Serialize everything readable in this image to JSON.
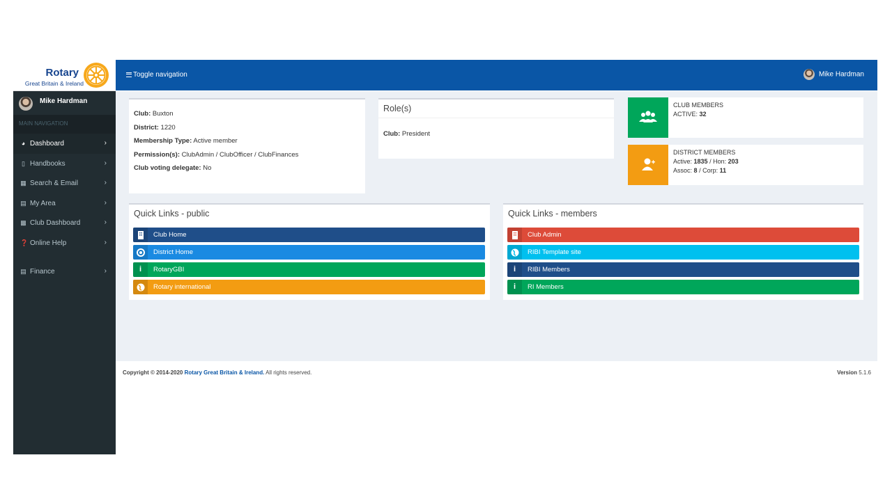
{
  "logo": {
    "title": "Rotary",
    "subtitle": "Great Britain & Ireland"
  },
  "topbar": {
    "toggle_label": "Toggle navigation",
    "user_name": "Mike Hardman"
  },
  "sidebar": {
    "user_name": "Mike Hardman",
    "header": "MAIN NAVIGATION",
    "items": [
      {
        "label": "Dashboard",
        "icon": "dashboard-icon"
      },
      {
        "label": "Handbooks",
        "icon": "book-icon"
      },
      {
        "label": "Search & Email",
        "icon": "table-icon"
      },
      {
        "label": "My Area",
        "icon": "database-icon"
      },
      {
        "label": "Club Dashboard",
        "icon": "building-icon"
      },
      {
        "label": "Online Help",
        "icon": "question-icon"
      },
      {
        "label": "Finance",
        "icon": "database-icon"
      }
    ]
  },
  "club_info": {
    "club_label": "Club:",
    "club_value": "Buxton",
    "district_label": "District:",
    "district_value": "1220",
    "membership_label": "Membership Type:",
    "membership_value": "Active member",
    "permissions_label": "Permission(s):",
    "permissions_value": "ClubAdmin / ClubOfficer / ClubFinances",
    "voting_label": "Club voting delegate:",
    "voting_value": "No"
  },
  "roles": {
    "title": "Role(s)",
    "club_label": "Club:",
    "club_value": "President"
  },
  "club_members": {
    "title": "CLUB MEMBERS",
    "active_label": "ACTIVE:",
    "active_value": "32",
    "color": "#00a65a"
  },
  "district_members": {
    "title": "DISTRICT MEMBERS",
    "active_label": "Active:",
    "active_value": "1835",
    "hon_label": "/ Hon:",
    "hon_value": "203",
    "assoc_label": "Assoc:",
    "assoc_value": "8",
    "corp_label": "/ Corp:",
    "corp_value": "11",
    "color": "#f39c12"
  },
  "quick_public": {
    "title": "Quick Links - public",
    "links": [
      {
        "label": "Club Home",
        "color": "#1f4e89",
        "icon": "building-icon"
      },
      {
        "label": "District Home",
        "color": "#1a8ae2",
        "icon": "life-ring-icon"
      },
      {
        "label": "RotaryGBI",
        "color": "#00a65a",
        "icon": "info-icon"
      },
      {
        "label": "Rotary international",
        "color": "#f39c12",
        "icon": "globe-icon"
      }
    ]
  },
  "quick_members": {
    "title": "Quick Links - members",
    "links": [
      {
        "label": "Club Admin",
        "color": "#dd4b39",
        "icon": "building-icon"
      },
      {
        "label": "RIBI Template site",
        "color": "#00c0ef",
        "icon": "globe-icon"
      },
      {
        "label": "RIBI Members",
        "color": "#1f4e89",
        "icon": "info-icon"
      },
      {
        "label": "RI Members",
        "color": "#00a65a",
        "icon": "info-icon"
      }
    ]
  },
  "footer": {
    "copyright": "Copyright © 2014-2020",
    "org_link": "Rotary Great Britain & Ireland.",
    "rights": "All rights reserved.",
    "version_label": "Version",
    "version_value": "5.1.6"
  }
}
